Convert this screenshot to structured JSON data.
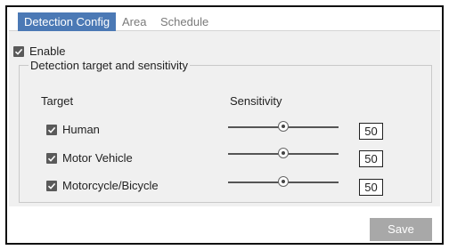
{
  "tabs": [
    {
      "label": "Detection Config",
      "active": true
    },
    {
      "label": "Area",
      "active": false
    },
    {
      "label": "Schedule",
      "active": false
    }
  ],
  "enable": {
    "label": "Enable",
    "checked": true
  },
  "group": {
    "legend": "Detection target and sensitivity",
    "target_header": "Target",
    "sensitivity_header": "Sensitivity",
    "rows": [
      {
        "label": "Human",
        "checked": true,
        "value": "50",
        "level": 0.5
      },
      {
        "label": "Motor Vehicle",
        "checked": true,
        "value": "50",
        "level": 0.5
      },
      {
        "label": "Motorcycle/Bicycle",
        "checked": true,
        "value": "50",
        "level": 0.5
      }
    ]
  },
  "save_label": "Save",
  "colors": {
    "tab_active": "#4b79b5",
    "panel_bg": "#f0f0f0",
    "button_bg": "#a8a8a8"
  }
}
